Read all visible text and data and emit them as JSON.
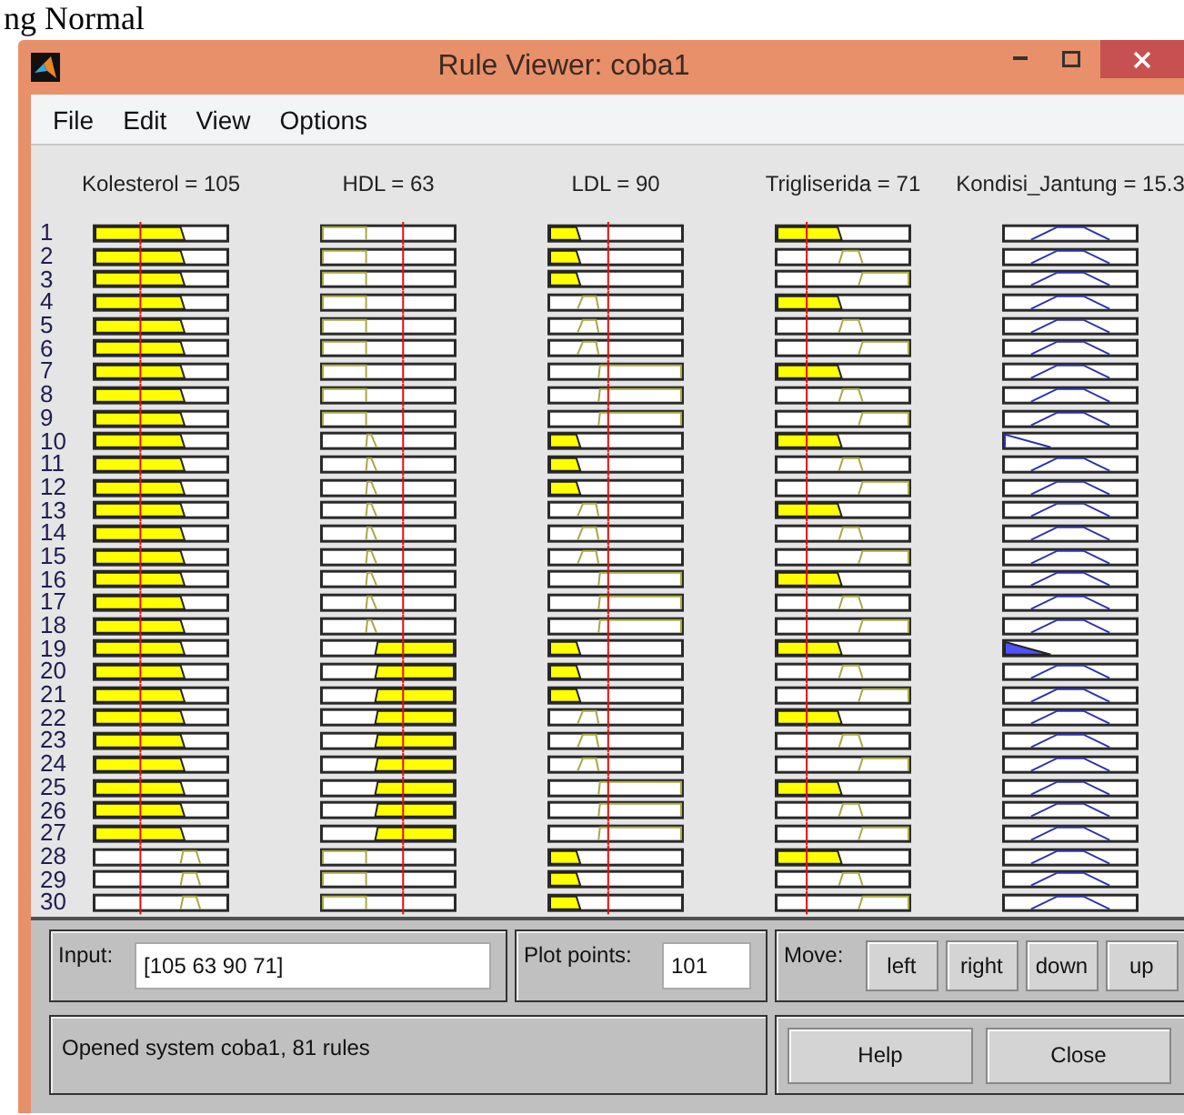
{
  "document_text": "ng Normal",
  "window": {
    "title": "Rule Viewer: coba1"
  },
  "menu": [
    "File",
    "Edit",
    "View",
    "Options"
  ],
  "variables": [
    {
      "label": "Kolesterol = 105",
      "kind": "input",
      "level": 0.35
    },
    {
      "label": "HDL = 63",
      "kind": "input",
      "level": 0.62
    },
    {
      "label": "LDL = 90",
      "kind": "input",
      "level": 0.45
    },
    {
      "label": "Trigliserida = 71",
      "kind": "input",
      "level": 0.23
    },
    {
      "label": "Kondisi_Jantung = 15.3",
      "kind": "output"
    }
  ],
  "rules": [
    {
      "number": "1",
      "cells": [
        {
          "kind": "low",
          "fired": true
        },
        {
          "kind": "low",
          "fired": false
        },
        {
          "kind": "low",
          "fired": true
        },
        {
          "kind": "low",
          "fired": true
        },
        {
          "kind": "mid",
          "fired": false
        }
      ]
    },
    {
      "number": "2",
      "cells": [
        {
          "kind": "low",
          "fired": true
        },
        {
          "kind": "low",
          "fired": false
        },
        {
          "kind": "low",
          "fired": true
        },
        {
          "kind": "mid",
          "fired": false
        },
        {
          "kind": "mid",
          "fired": false
        }
      ]
    },
    {
      "number": "3",
      "cells": [
        {
          "kind": "low",
          "fired": true
        },
        {
          "kind": "low",
          "fired": false
        },
        {
          "kind": "low",
          "fired": true
        },
        {
          "kind": "high",
          "fired": false
        },
        {
          "kind": "mid",
          "fired": false
        }
      ]
    },
    {
      "number": "4",
      "cells": [
        {
          "kind": "low",
          "fired": true
        },
        {
          "kind": "low",
          "fired": false
        },
        {
          "kind": "mid",
          "fired": false
        },
        {
          "kind": "low",
          "fired": true
        },
        {
          "kind": "mid",
          "fired": false
        }
      ]
    },
    {
      "number": "5",
      "cells": [
        {
          "kind": "low",
          "fired": true
        },
        {
          "kind": "low",
          "fired": false
        },
        {
          "kind": "mid",
          "fired": false
        },
        {
          "kind": "mid",
          "fired": false
        },
        {
          "kind": "mid",
          "fired": false
        }
      ]
    },
    {
      "number": "6",
      "cells": [
        {
          "kind": "low",
          "fired": true
        },
        {
          "kind": "low",
          "fired": false
        },
        {
          "kind": "mid",
          "fired": false
        },
        {
          "kind": "high",
          "fired": false
        },
        {
          "kind": "mid",
          "fired": false
        }
      ]
    },
    {
      "number": "7",
      "cells": [
        {
          "kind": "low",
          "fired": true
        },
        {
          "kind": "low",
          "fired": false
        },
        {
          "kind": "high",
          "fired": false
        },
        {
          "kind": "low",
          "fired": true
        },
        {
          "kind": "mid",
          "fired": false
        }
      ]
    },
    {
      "number": "8",
      "cells": [
        {
          "kind": "low",
          "fired": true
        },
        {
          "kind": "low",
          "fired": false
        },
        {
          "kind": "high",
          "fired": false
        },
        {
          "kind": "mid",
          "fired": false
        },
        {
          "kind": "mid",
          "fired": false
        }
      ]
    },
    {
      "number": "9",
      "cells": [
        {
          "kind": "low",
          "fired": true
        },
        {
          "kind": "low",
          "fired": false
        },
        {
          "kind": "high",
          "fired": false
        },
        {
          "kind": "high",
          "fired": false
        },
        {
          "kind": "mid",
          "fired": false
        }
      ]
    },
    {
      "number": "10",
      "cells": [
        {
          "kind": "low",
          "fired": true
        },
        {
          "kind": "mid",
          "fired": false
        },
        {
          "kind": "low",
          "fired": true
        },
        {
          "kind": "low",
          "fired": true
        },
        {
          "kind": "low",
          "fired": false
        }
      ]
    },
    {
      "number": "11",
      "cells": [
        {
          "kind": "low",
          "fired": true
        },
        {
          "kind": "mid",
          "fired": false
        },
        {
          "kind": "low",
          "fired": true
        },
        {
          "kind": "mid",
          "fired": false
        },
        {
          "kind": "mid",
          "fired": false
        }
      ]
    },
    {
      "number": "12",
      "cells": [
        {
          "kind": "low",
          "fired": true
        },
        {
          "kind": "mid",
          "fired": false
        },
        {
          "kind": "low",
          "fired": true
        },
        {
          "kind": "high",
          "fired": false
        },
        {
          "kind": "mid",
          "fired": false
        }
      ]
    },
    {
      "number": "13",
      "cells": [
        {
          "kind": "low",
          "fired": true
        },
        {
          "kind": "mid",
          "fired": false
        },
        {
          "kind": "mid",
          "fired": false
        },
        {
          "kind": "low",
          "fired": true
        },
        {
          "kind": "mid",
          "fired": false
        }
      ]
    },
    {
      "number": "14",
      "cells": [
        {
          "kind": "low",
          "fired": true
        },
        {
          "kind": "mid",
          "fired": false
        },
        {
          "kind": "mid",
          "fired": false
        },
        {
          "kind": "mid",
          "fired": false
        },
        {
          "kind": "mid",
          "fired": false
        }
      ]
    },
    {
      "number": "15",
      "cells": [
        {
          "kind": "low",
          "fired": true
        },
        {
          "kind": "mid",
          "fired": false
        },
        {
          "kind": "mid",
          "fired": false
        },
        {
          "kind": "high",
          "fired": false
        },
        {
          "kind": "mid",
          "fired": false
        }
      ]
    },
    {
      "number": "16",
      "cells": [
        {
          "kind": "low",
          "fired": true
        },
        {
          "kind": "mid",
          "fired": false
        },
        {
          "kind": "high",
          "fired": false
        },
        {
          "kind": "low",
          "fired": true
        },
        {
          "kind": "mid",
          "fired": false
        }
      ]
    },
    {
      "number": "17",
      "cells": [
        {
          "kind": "low",
          "fired": true
        },
        {
          "kind": "mid",
          "fired": false
        },
        {
          "kind": "high",
          "fired": false
        },
        {
          "kind": "mid",
          "fired": false
        },
        {
          "kind": "mid",
          "fired": false
        }
      ]
    },
    {
      "number": "18",
      "cells": [
        {
          "kind": "low",
          "fired": true
        },
        {
          "kind": "mid",
          "fired": false
        },
        {
          "kind": "high",
          "fired": false
        },
        {
          "kind": "high",
          "fired": false
        },
        {
          "kind": "mid",
          "fired": false
        }
      ]
    },
    {
      "number": "19",
      "cells": [
        {
          "kind": "low",
          "fired": true
        },
        {
          "kind": "high",
          "fired": true
        },
        {
          "kind": "low",
          "fired": true
        },
        {
          "kind": "low",
          "fired": true
        },
        {
          "kind": "low",
          "fired": true
        }
      ]
    },
    {
      "number": "20",
      "cells": [
        {
          "kind": "low",
          "fired": true
        },
        {
          "kind": "high",
          "fired": true
        },
        {
          "kind": "low",
          "fired": true
        },
        {
          "kind": "mid",
          "fired": false
        },
        {
          "kind": "mid",
          "fired": false
        }
      ]
    },
    {
      "number": "21",
      "cells": [
        {
          "kind": "low",
          "fired": true
        },
        {
          "kind": "high",
          "fired": true
        },
        {
          "kind": "low",
          "fired": true
        },
        {
          "kind": "high",
          "fired": false
        },
        {
          "kind": "mid",
          "fired": false
        }
      ]
    },
    {
      "number": "22",
      "cells": [
        {
          "kind": "low",
          "fired": true
        },
        {
          "kind": "high",
          "fired": true
        },
        {
          "kind": "mid",
          "fired": false
        },
        {
          "kind": "low",
          "fired": true
        },
        {
          "kind": "mid",
          "fired": false
        }
      ]
    },
    {
      "number": "23",
      "cells": [
        {
          "kind": "low",
          "fired": true
        },
        {
          "kind": "high",
          "fired": true
        },
        {
          "kind": "mid",
          "fired": false
        },
        {
          "kind": "mid",
          "fired": false
        },
        {
          "kind": "mid",
          "fired": false
        }
      ]
    },
    {
      "number": "24",
      "cells": [
        {
          "kind": "low",
          "fired": true
        },
        {
          "kind": "high",
          "fired": true
        },
        {
          "kind": "mid",
          "fired": false
        },
        {
          "kind": "high",
          "fired": false
        },
        {
          "kind": "mid",
          "fired": false
        }
      ]
    },
    {
      "number": "25",
      "cells": [
        {
          "kind": "low",
          "fired": true
        },
        {
          "kind": "high",
          "fired": true
        },
        {
          "kind": "high",
          "fired": false
        },
        {
          "kind": "low",
          "fired": true
        },
        {
          "kind": "mid",
          "fired": false
        }
      ]
    },
    {
      "number": "26",
      "cells": [
        {
          "kind": "low",
          "fired": true
        },
        {
          "kind": "high",
          "fired": true
        },
        {
          "kind": "high",
          "fired": false
        },
        {
          "kind": "mid",
          "fired": false
        },
        {
          "kind": "mid",
          "fired": false
        }
      ]
    },
    {
      "number": "27",
      "cells": [
        {
          "kind": "low",
          "fired": true
        },
        {
          "kind": "high",
          "fired": true
        },
        {
          "kind": "high",
          "fired": false
        },
        {
          "kind": "high",
          "fired": false
        },
        {
          "kind": "mid",
          "fired": false
        }
      ]
    },
    {
      "number": "28",
      "cells": [
        {
          "kind": "mid",
          "fired": false
        },
        {
          "kind": "low",
          "fired": false
        },
        {
          "kind": "low",
          "fired": true
        },
        {
          "kind": "low",
          "fired": true
        },
        {
          "kind": "mid",
          "fired": false
        }
      ]
    },
    {
      "number": "29",
      "cells": [
        {
          "kind": "mid",
          "fired": false
        },
        {
          "kind": "low",
          "fired": false
        },
        {
          "kind": "low",
          "fired": true
        },
        {
          "kind": "mid",
          "fired": false
        },
        {
          "kind": "mid",
          "fired": false
        }
      ]
    },
    {
      "number": "30",
      "cells": [
        {
          "kind": "mid",
          "fired": false
        },
        {
          "kind": "low",
          "fired": false
        },
        {
          "kind": "low",
          "fired": true
        },
        {
          "kind": "high",
          "fired": false
        },
        {
          "kind": "mid",
          "fired": false
        }
      ]
    }
  ],
  "input": {
    "label": "Input:",
    "value": "[105 63 90 71]"
  },
  "plot_points": {
    "label": "Plot points:",
    "value": "101"
  },
  "move": {
    "label": "Move:",
    "buttons": [
      "left",
      "right",
      "down",
      "up"
    ]
  },
  "status": "Opened system coba1, 81 rules",
  "buttons": [
    "Help",
    "Close"
  ]
}
